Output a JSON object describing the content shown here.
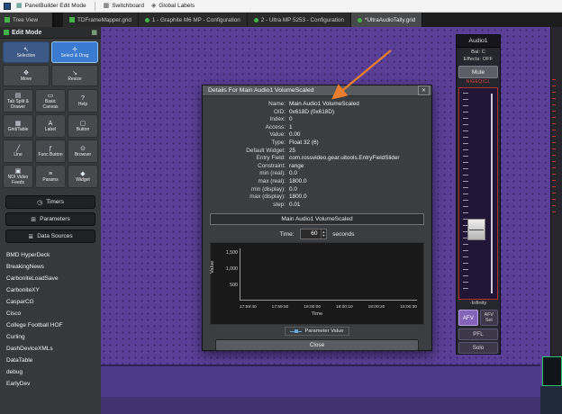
{
  "colors": {
    "canvas_purple": "#5a3f96",
    "accent_blue": "#3a7bd0",
    "status_green": "#43b24a",
    "tally_red": "#e04040",
    "annotation_orange": "#e87e2e",
    "afv_purple": "#8463b8"
  },
  "menubar": {
    "panelbuilder": {
      "icon": "grid-icon",
      "glyph": "▦",
      "label": "PanelBuilder Edit Mode"
    },
    "switchboard": {
      "icon": "switchboard-icon",
      "glyph": "▩",
      "label": "Switchboard"
    },
    "global_labels": {
      "icon": "labels-icon",
      "glyph": "◈",
      "label": "Global Labels"
    }
  },
  "tabs": {
    "tree_view": "Tree View",
    "items": [
      {
        "label": "TDFrameMapper.grid",
        "icon": "grid-file-icon"
      },
      {
        "label": "1 - Graphite M6 MP - Configuration",
        "icon": "status-dot-icon"
      },
      {
        "label": "2 - Ultra MP 5253 - Configuration",
        "icon": "status-dot-icon"
      },
      {
        "label": "*UltraAudioTally.grid",
        "icon": "status-dot-icon"
      }
    ],
    "active_index": 3
  },
  "sidebar": {
    "title": "Edit Mode",
    "header_icon": "grid-icon",
    "header_glyph": "▦",
    "tools_main": [
      {
        "icon": "cursor-icon",
        "glyph": "↖",
        "label": "Selection"
      },
      {
        "icon": "cursor-drag-icon",
        "glyph": "✛",
        "label": "Select & Drag"
      },
      {
        "icon": "move-icon",
        "glyph": "✥",
        "label": "Move"
      },
      {
        "icon": "resize-icon",
        "glyph": "↘",
        "label": "Resize"
      }
    ],
    "tools_widgets": [
      {
        "icon": "tab-split-icon",
        "glyph": "▤",
        "label": "Tab Split & Drawer"
      },
      {
        "icon": "canvas-icon",
        "glyph": "▭",
        "label": "Basic Canvas"
      },
      {
        "icon": "help-icon",
        "glyph": "?",
        "label": "Help"
      },
      {
        "icon": "grid-table-icon",
        "glyph": "▦",
        "label": "Grid/Table"
      },
      {
        "icon": "label-icon",
        "glyph": "A",
        "label": "Label"
      },
      {
        "icon": "button-icon",
        "glyph": "▢",
        "label": "Button"
      },
      {
        "icon": "line-icon",
        "glyph": "╱",
        "label": "Line"
      },
      {
        "icon": "func-button-icon",
        "glyph": "ƒ",
        "label": "Func Button"
      },
      {
        "icon": "browser-icon",
        "glyph": "⊙",
        "label": "Browser"
      },
      {
        "icon": "ndi-icon",
        "glyph": "▣",
        "label": "NDI Video Feeds"
      },
      {
        "icon": "params-icon",
        "glyph": "≡",
        "label": "Params"
      },
      {
        "icon": "widget-icon",
        "glyph": "◆",
        "label": "Widget"
      }
    ],
    "sections": [
      {
        "icon": "timer-icon",
        "glyph": "◷",
        "label": "Timers"
      },
      {
        "icon": "parameters-icon",
        "glyph": "⊞",
        "label": "Parameters"
      },
      {
        "icon": "data-sources-icon",
        "glyph": "≣",
        "label": "Data Sources"
      }
    ],
    "tree_items": [
      "BMD HyperDeck",
      "BreakingNews",
      "CarboniteLoadSave",
      "CarboniteXY",
      "CasparCG",
      "Cisco",
      "College Football HOF",
      "Curling",
      "DashDeviceXMLs",
      "DataTable",
      "debug",
      "EarlyDev"
    ]
  },
  "dialog": {
    "title": "Details For Main Audio1 VolumeScaled",
    "close_x": "✕",
    "fields": [
      {
        "label": "Name:",
        "value": "Main Audio1 VolumeScaled"
      },
      {
        "label": "OID:",
        "value": "0x618D (0x618D)"
      },
      {
        "label": "Index:",
        "value": "0"
      },
      {
        "label": "Access:",
        "value": "1"
      },
      {
        "label": "Value:",
        "value": "0.00"
      },
      {
        "label": "Type:",
        "value": "Float 32 (6)"
      },
      {
        "label": "Default Widget:",
        "value": "25"
      },
      {
        "label": "Entry Field:",
        "value": "com.rossvideo.gear.uitools.EntryFieldSlider"
      },
      {
        "label": "Constraint:",
        "value": "range"
      },
      {
        "label": "min (real):",
        "value": "0.0"
      },
      {
        "label": "max (real):",
        "value": "1800.0"
      },
      {
        "label": "min (display):",
        "value": "0.0"
      },
      {
        "label": "max (display):",
        "value": "1800.0"
      },
      {
        "label": "step:",
        "value": "0.01"
      }
    ],
    "param_header": "Main Audio1 VolumeScaled",
    "time_label": "Time:",
    "time_value": "60",
    "spin_up": "▲",
    "spin_down": "▼",
    "time_units": "seconds",
    "close_label": "Close"
  },
  "chart_data": {
    "type": "line",
    "ylabel": "Value",
    "xlabel": "Time",
    "y_ticks": [
      "1,500",
      "1,000",
      "500"
    ],
    "x_ticks": [
      "17:59:40",
      "17:59:50",
      "18:00:00",
      "18:00:10",
      "18:00:20",
      "18:00:30"
    ],
    "ylim": [
      0,
      1800
    ],
    "x_range": [
      "17:59:40",
      "18:00:30"
    ],
    "grid": false,
    "legend_position": "bottom",
    "legend": "Parameter Value",
    "series": [
      {
        "name": "Parameter Value",
        "values": [
          0,
          0,
          0,
          0,
          0,
          0
        ]
      }
    ]
  },
  "audio_panel": {
    "title": "Audio1",
    "bal": "Bal:  C",
    "effects": "Effects: OFF",
    "mute": "Mute",
    "tally": "NIGEQICL",
    "infinity": "-Infinity",
    "afv": "AFV",
    "afv_set": "AFV Set",
    "pfl": "PFL",
    "solo": "Solo"
  }
}
